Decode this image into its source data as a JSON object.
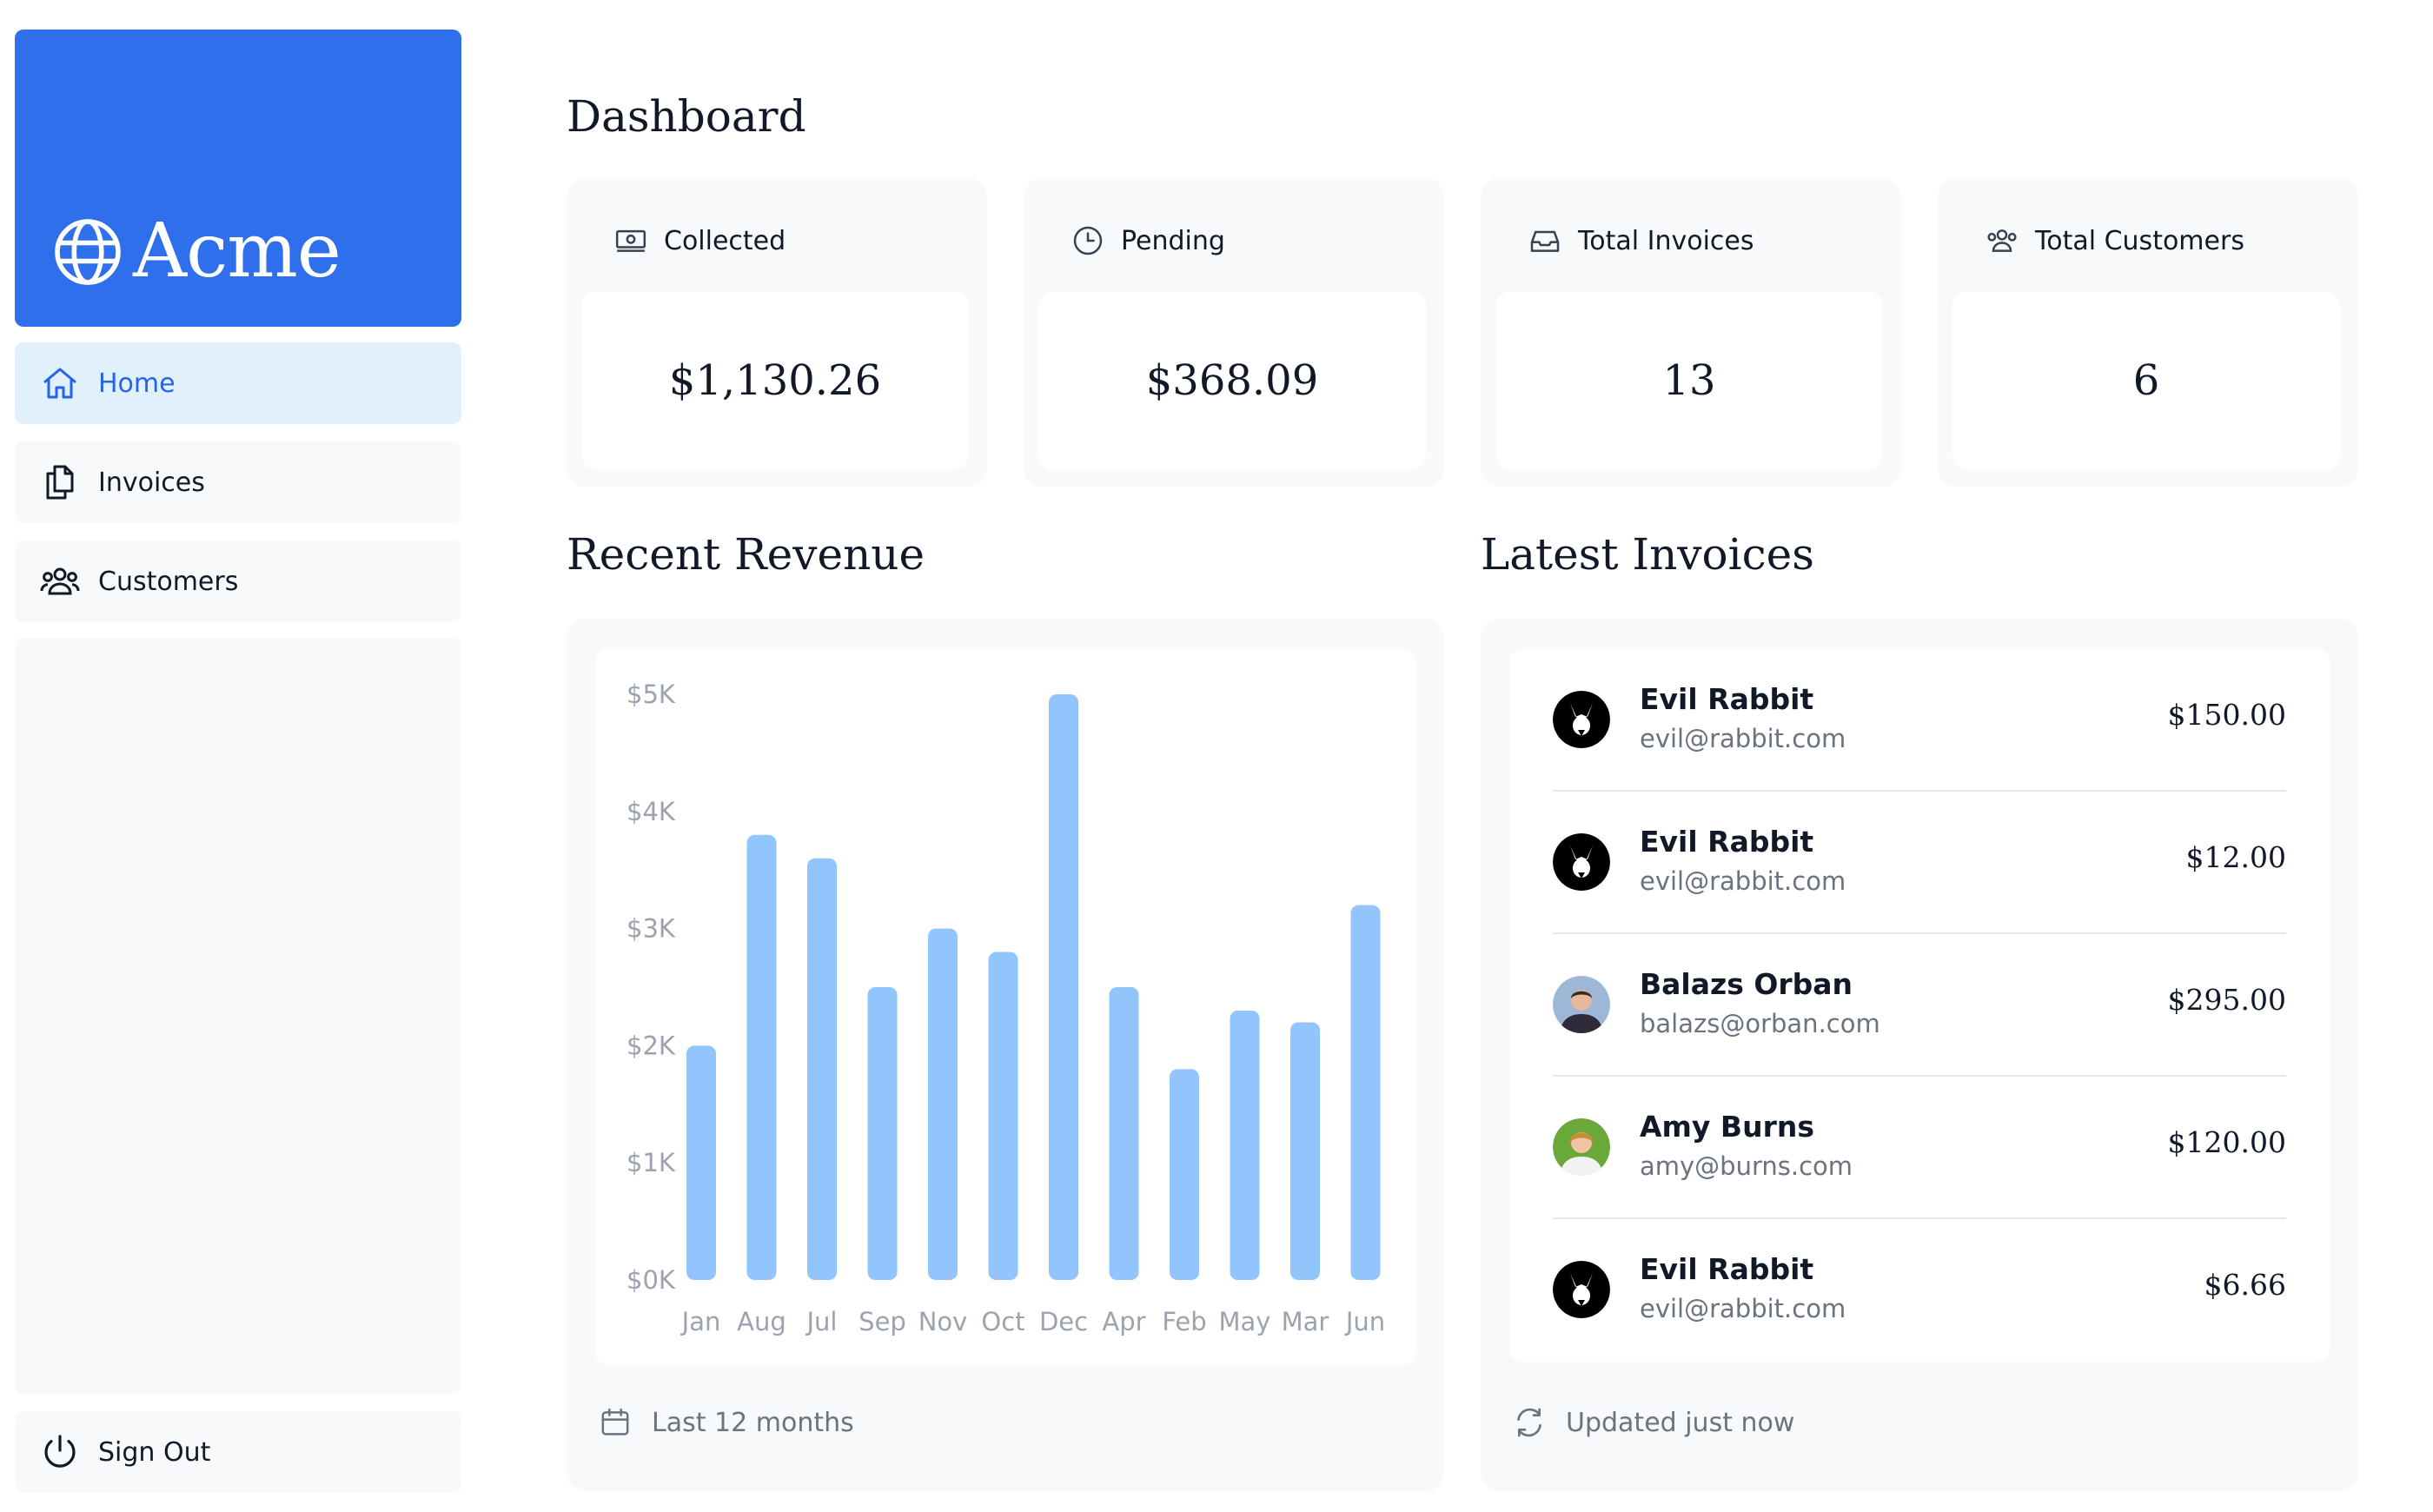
{
  "app": {
    "name": "Acme"
  },
  "sidebar": {
    "items": [
      {
        "label": "Home",
        "icon": "home-icon",
        "active": true
      },
      {
        "label": "Invoices",
        "icon": "documents-icon",
        "active": false
      },
      {
        "label": "Customers",
        "icon": "users-icon",
        "active": false
      }
    ],
    "sign_out": "Sign Out"
  },
  "main": {
    "title": "Dashboard",
    "cards": [
      {
        "title": "Collected",
        "value": "$1,130.26",
        "icon": "banknotes-icon"
      },
      {
        "title": "Pending",
        "value": "$368.09",
        "icon": "clock-icon"
      },
      {
        "title": "Total Invoices",
        "value": "13",
        "icon": "inbox-icon"
      },
      {
        "title": "Total Customers",
        "value": "6",
        "icon": "users-icon"
      }
    ],
    "revenue": {
      "title": "Recent Revenue",
      "footer": "Last 12 months"
    },
    "latest": {
      "title": "Latest Invoices",
      "footer": "Updated just now",
      "invoices": [
        {
          "name": "Evil Rabbit",
          "email": "evil@rabbit.com",
          "amount": "$150.00",
          "avatar": "evil-rabbit"
        },
        {
          "name": "Evil Rabbit",
          "email": "evil@rabbit.com",
          "amount": "$12.00",
          "avatar": "evil-rabbit"
        },
        {
          "name": "Balazs Orban",
          "email": "balazs@orban.com",
          "amount": "$295.00",
          "avatar": "balazs-orban"
        },
        {
          "name": "Amy Burns",
          "email": "amy@burns.com",
          "amount": "$120.00",
          "avatar": "amy-burns"
        },
        {
          "name": "Evil Rabbit",
          "email": "evil@rabbit.com",
          "amount": "$6.66",
          "avatar": "evil-rabbit"
        }
      ]
    }
  },
  "colors": {
    "accent": "#2f6feb",
    "bar": "#93c5fd",
    "active_bg": "#e0f0fd",
    "muted": "#6b7280"
  },
  "chart_data": {
    "type": "bar",
    "categories": [
      "Jan",
      "Aug",
      "Jul",
      "Sep",
      "Nov",
      "Oct",
      "Dec",
      "Apr",
      "Feb",
      "May",
      "Mar",
      "Jun"
    ],
    "values": [
      2000,
      3800,
      3600,
      2500,
      3000,
      2800,
      5000,
      2500,
      1800,
      2300,
      2200,
      3200
    ],
    "yticks": [
      "$0K",
      "$1K",
      "$2K",
      "$3K",
      "$4K",
      "$5K"
    ],
    "ylim": [
      0,
      5000
    ],
    "grid": false
  }
}
